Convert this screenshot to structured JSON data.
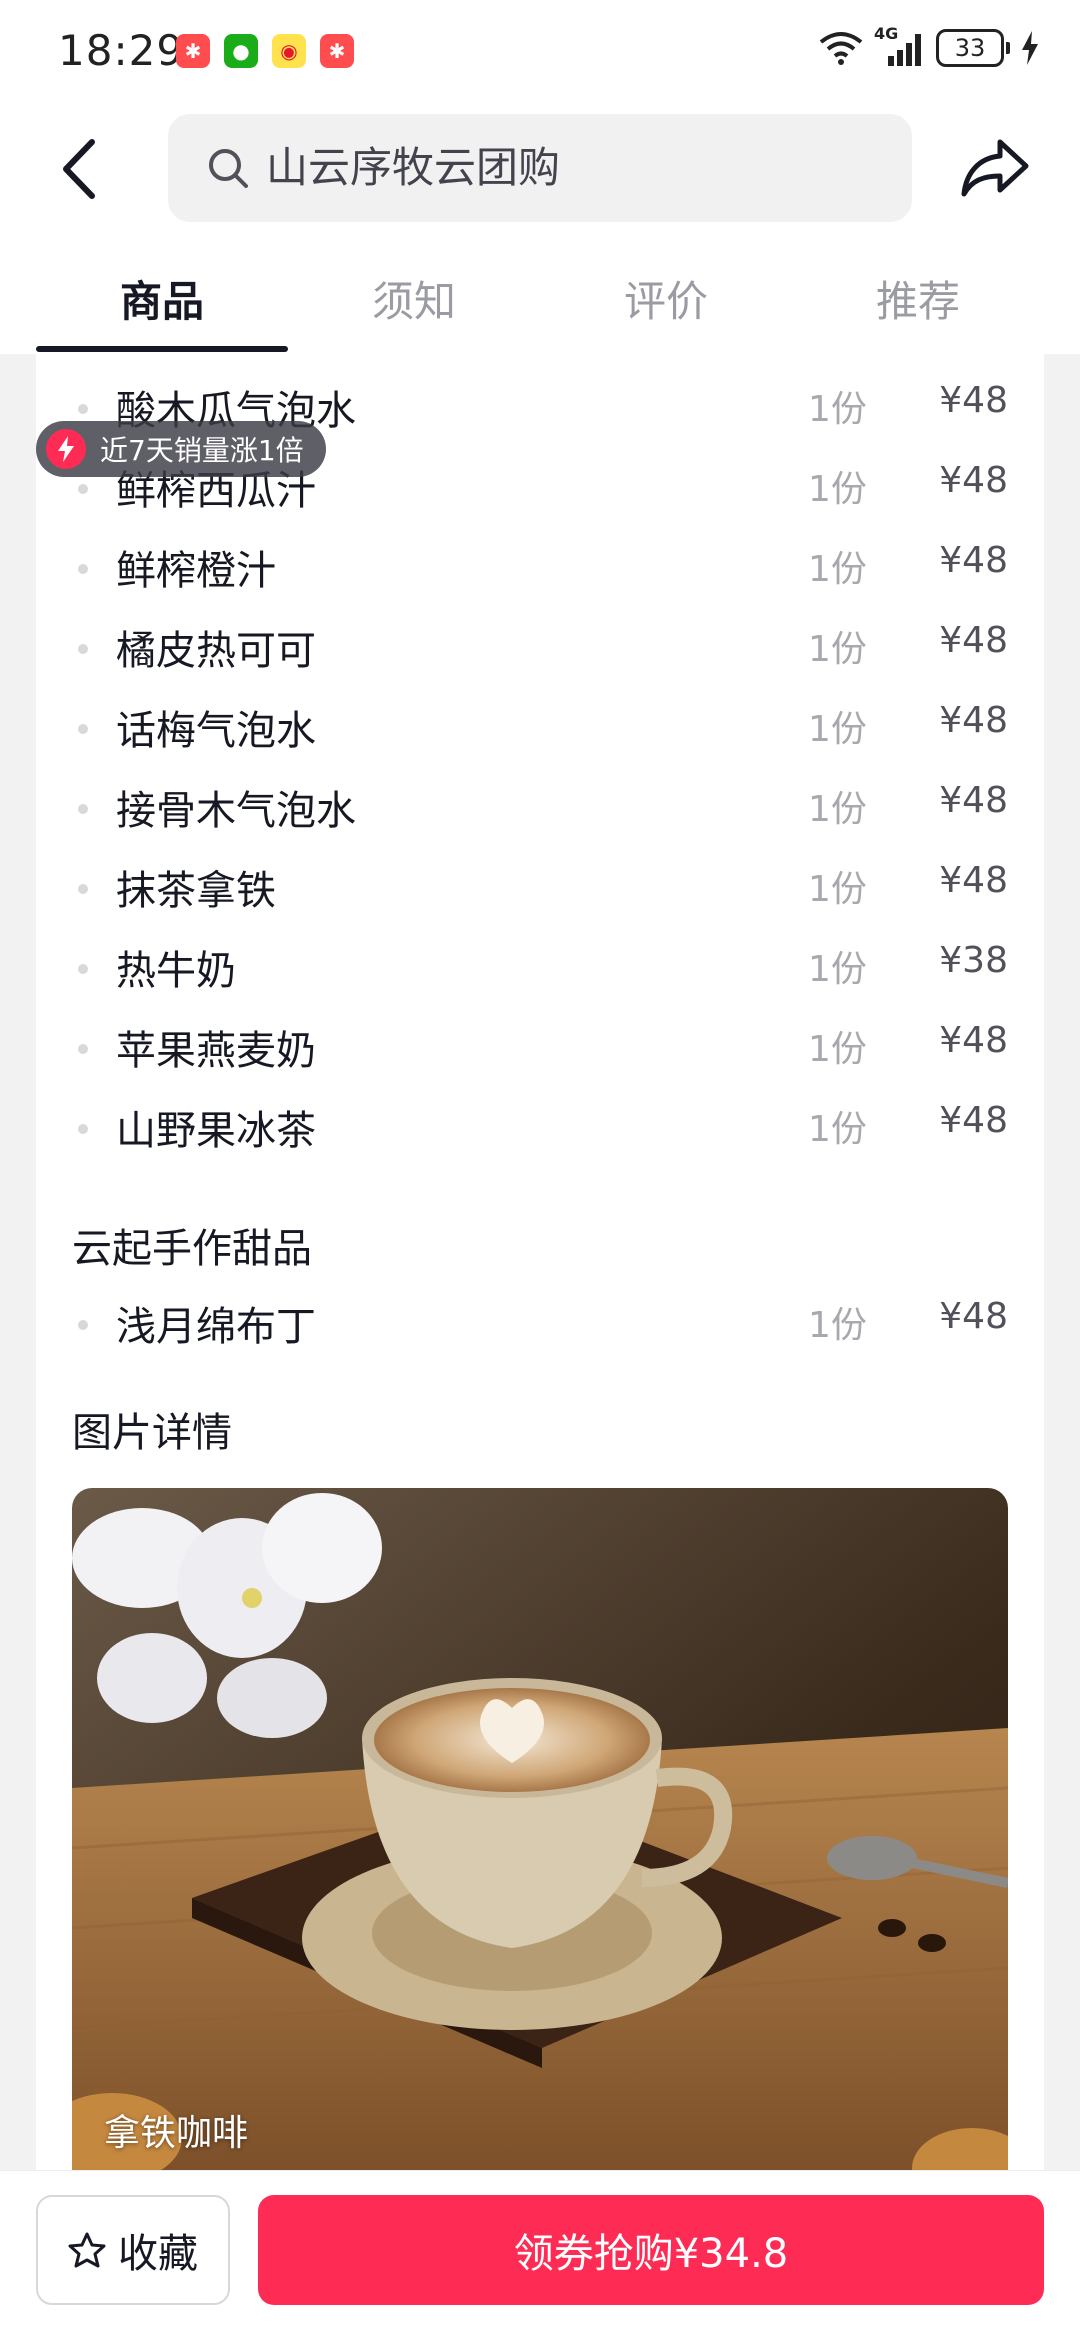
{
  "status_bar": {
    "time": "18:29",
    "network": "4G",
    "battery": "33",
    "notification_icons": [
      "app-notification-icon",
      "wechat-icon",
      "weibo-icon",
      "app-notification-icon"
    ]
  },
  "header": {
    "search_text": "山云序牧云团购"
  },
  "tabs": [
    {
      "label": "商品"
    },
    {
      "label": "须知"
    },
    {
      "label": "评价"
    },
    {
      "label": "推荐"
    }
  ],
  "promo_badge": "近7天销量涨1倍",
  "items": [
    {
      "name": "酸木瓜气泡水",
      "qty": "1份",
      "price": "¥48"
    },
    {
      "name": "鲜榨西瓜汁",
      "qty": "1份",
      "price": "¥48"
    },
    {
      "name": "鲜榨橙汁",
      "qty": "1份",
      "price": "¥48"
    },
    {
      "name": "橘皮热可可",
      "qty": "1份",
      "price": "¥48"
    },
    {
      "name": "话梅气泡水",
      "qty": "1份",
      "price": "¥48"
    },
    {
      "name": "接骨木气泡水",
      "qty": "1份",
      "price": "¥48"
    },
    {
      "name": "抹茶拿铁",
      "qty": "1份",
      "price": "¥48"
    },
    {
      "name": "热牛奶",
      "qty": "1份",
      "price": "¥38"
    },
    {
      "name": "苹果燕麦奶",
      "qty": "1份",
      "price": "¥48"
    },
    {
      "name": "山野果冰茶",
      "qty": "1份",
      "price": "¥48"
    }
  ],
  "dessert_section": {
    "title": "云起手作甜品",
    "items": [
      {
        "name": "浅月绵布丁",
        "qty": "1份",
        "price": "¥48"
      }
    ]
  },
  "photo_section": {
    "title": "图片详情",
    "caption": "拿铁咖啡"
  },
  "bottom_bar": {
    "favorite_label": "收藏",
    "buy_label": "领券抢购¥34.8"
  },
  "colors": {
    "accent": "#fe2c55",
    "text_primary": "#161823",
    "text_muted": "#a8a9ae"
  }
}
